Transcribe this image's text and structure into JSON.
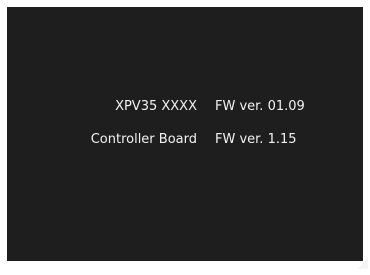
{
  "screen": {
    "background_color": "#1e1e1e",
    "text_color": "#f2f2f2",
    "firmware_info": [
      {
        "device": "XPV35 XXXX",
        "version": "FW ver. 01.09"
      },
      {
        "device": "Controller Board",
        "version": "FW ver. 1.15"
      }
    ]
  }
}
